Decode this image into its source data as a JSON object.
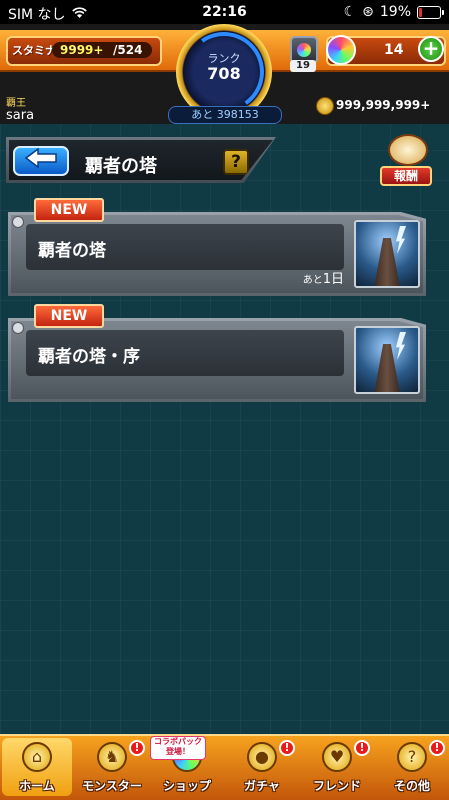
{
  "status_bar": {
    "carrier": "SIM なし",
    "time": "22:16",
    "battery": "19%",
    "battery_level": 0.19
  },
  "header": {
    "stamina_label": "スタミナ",
    "stamina_value": "9999+",
    "stamina_max": "/524",
    "rank_label": "ランク",
    "rank_value": "708",
    "exp_remaining": "あと 398153",
    "lantern_count": "19",
    "orb_count": "14",
    "player_title": "覇王",
    "username": "sara",
    "gold": "999,999,999+"
  },
  "page": {
    "title": "覇者の塔",
    "help_label": "?",
    "reward_label": "報酬"
  },
  "quests": [
    {
      "tag": "NEW",
      "name": "覇者の塔",
      "remaining_prefix": "あと",
      "remaining": "1日"
    },
    {
      "tag": "NEW",
      "name": "覇者の塔・序",
      "remaining_prefix": "",
      "remaining": ""
    }
  ],
  "bottom_nav": {
    "items": [
      {
        "label": "ホーム",
        "icon": "home-icon",
        "alert": ""
      },
      {
        "label": "モンスター",
        "icon": "monster-icon",
        "alert": "!"
      },
      {
        "label": "ショップ",
        "icon": "shop-icon",
        "alert": ""
      },
      {
        "label": "ガチャ",
        "icon": "gacha-icon",
        "alert": "!"
      },
      {
        "label": "フレンド",
        "icon": "friend-icon",
        "alert": "!"
      },
      {
        "label": "その他",
        "icon": "other-icon",
        "alert": "!"
      }
    ],
    "promo": "コラボパック登場！"
  },
  "colors": {
    "background": "#103b45",
    "accent_orange": "#f7a21e",
    "new_tag": "#e03a1a"
  }
}
